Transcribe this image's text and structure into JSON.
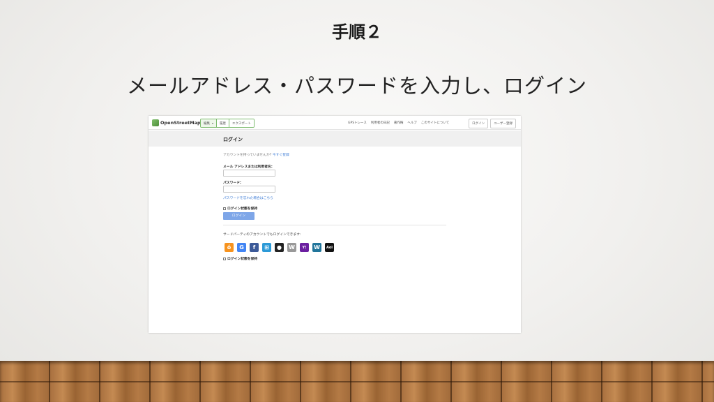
{
  "slide": {
    "title": "手順２",
    "subtitle": "メールアドレス・パスワードを入力し、ログイン"
  },
  "osm": {
    "brand": "OpenStreetMap",
    "tools": [
      "編集",
      "履歴",
      "エクスポート"
    ],
    "nav": [
      "GPSトレース",
      "利用者の日記",
      "著作権",
      "ヘルプ",
      "このサイトについて"
    ],
    "auth": [
      "ログイン",
      "ユーザー登録"
    ],
    "page_title": "ログイン",
    "no_account_text": "アカウントを持っていませんか?",
    "register_link": "今すぐ登録",
    "email_label": "メール アドレスまたは利用者名:",
    "password_label": "パスワード:",
    "forgot_link": "パスワードを忘れた場合はこちら",
    "remember_label": "ログイン状態を保持",
    "login_button": "ログイン",
    "third_party_text": "サードパーティのアカウントでもログインできます:",
    "providers": [
      {
        "icon": "openid-icon",
        "glyph": "ό",
        "color": "#f7931e"
      },
      {
        "icon": "google-icon",
        "glyph": "G",
        "color": "#4285f4"
      },
      {
        "icon": "facebook-icon",
        "glyph": "f",
        "color": "#3b5998"
      },
      {
        "icon": "windows-live-icon",
        "glyph": "⊞",
        "color": "#2d9ad7"
      },
      {
        "icon": "github-icon",
        "glyph": "●",
        "color": "#222222"
      },
      {
        "icon": "wikipedia-icon",
        "glyph": "W",
        "color": "#999999"
      },
      {
        "icon": "yahoo-icon",
        "glyph": "Y!",
        "color": "#6b1fa0"
      },
      {
        "icon": "wordpress-icon",
        "glyph": "W",
        "color": "#21759b"
      },
      {
        "icon": "aol-icon",
        "glyph": "Aol",
        "color": "#111111"
      }
    ],
    "remember_label_2": "ログイン状態を保持"
  }
}
